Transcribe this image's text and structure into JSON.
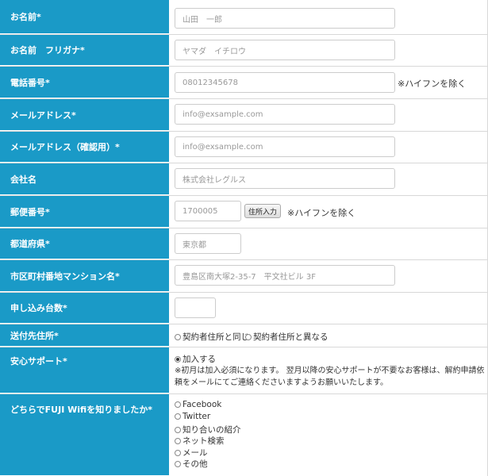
{
  "fields": {
    "name": {
      "label": "お名前*",
      "placeholder": "山田　一郎"
    },
    "kana": {
      "label": "お名前　フリガナ*",
      "placeholder": "ヤマダ　イチロウ"
    },
    "phone": {
      "label": "電話番号*",
      "placeholder": "08012345678",
      "note": "※ハイフンを除く"
    },
    "email": {
      "label": "メールアドレス*",
      "placeholder": "info@exsample.com"
    },
    "email_confirm": {
      "label": "メールアドレス（確認用）*",
      "placeholder": "info@exsample.com"
    },
    "company": {
      "label": "会社名",
      "placeholder": "株式会社レグルス"
    },
    "postal": {
      "label": "郵便番号*",
      "placeholder": "1700005",
      "button": "住所入力",
      "note": "※ハイフンを除く"
    },
    "prefecture": {
      "label": "都道府県*",
      "placeholder": "東京都"
    },
    "address": {
      "label": "市区町村番地マンション名*",
      "placeholder": "豊島区南大塚2-35-7　平文社ビル 3F"
    },
    "count": {
      "label": "申し込み台数*",
      "value": ""
    },
    "shipping": {
      "label": "送付先住所*",
      "options": [
        "契約者住所と同じ",
        "契約者住所と異なる"
      ]
    },
    "support": {
      "label": "安心サポート*",
      "option": "加入する",
      "note_line1": "※初月は加入必須になります。 翌月以降の安心サポートが不要なお客様は、解約申請依",
      "note_line2": "頼をメールにてご連絡くださいますようお願いいたします。"
    },
    "source": {
      "label": "どちらでFUJI Wifiを知りましたか*",
      "options": [
        "Facebook",
        "Twitter",
        "知り合いの紹介",
        "ネット検索",
        "メール",
        "その他"
      ]
    }
  }
}
